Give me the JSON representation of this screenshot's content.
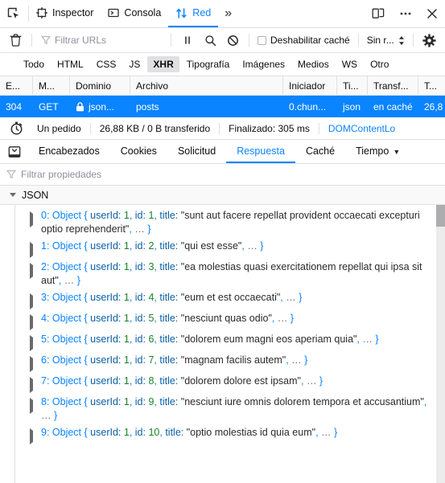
{
  "toolbox": {
    "picker_icon": "element-picker-icon",
    "tabs": [
      {
        "id": "inspector",
        "label": "Inspector",
        "icon": "inspector-icon",
        "selected": false
      },
      {
        "id": "console",
        "label": "Consola",
        "icon": "console-icon",
        "selected": false
      },
      {
        "id": "network",
        "label": "Red",
        "icon": "network-arrows-icon",
        "selected": true
      }
    ],
    "overflow_label": "»",
    "responsive_icon": "responsive-design-mode-icon",
    "meatball_label": "•••",
    "close_label": "✕"
  },
  "net_toolbar": {
    "clear_icon": "trash-icon",
    "filter_placeholder": "Filtrar URLs",
    "pause_icon": "pause-icon",
    "search_icon": "search-icon",
    "block_icon": "block-icon",
    "disable_cache_label": "Deshabilitar caché",
    "disable_cache_checked": false,
    "throttle_value": "Sin r...",
    "settings_icon": "gear-icon"
  },
  "type_filters": [
    {
      "label": "Todo",
      "active": false
    },
    {
      "label": "HTML",
      "active": false
    },
    {
      "label": "CSS",
      "active": false
    },
    {
      "label": "JS",
      "active": false
    },
    {
      "label": "XHR",
      "active": true
    },
    {
      "label": "Tipografía",
      "active": false
    },
    {
      "label": "Imágenes",
      "active": false
    },
    {
      "label": "Medios",
      "active": false
    },
    {
      "label": "WS",
      "active": false
    },
    {
      "label": "Otro",
      "active": false
    }
  ],
  "requests_table": {
    "columns": [
      {
        "key": "status",
        "label": "E..."
      },
      {
        "key": "method",
        "label": "M..."
      },
      {
        "key": "domain",
        "label": "Dominio"
      },
      {
        "key": "file",
        "label": "Archivo"
      },
      {
        "key": "initiator",
        "label": "Iniciador"
      },
      {
        "key": "type",
        "label": "Ti..."
      },
      {
        "key": "transferred",
        "label": "Transf..."
      },
      {
        "key": "size",
        "label": "T..."
      }
    ],
    "rows": [
      {
        "status": "304",
        "method": "GET",
        "lock_icon": "lock-icon",
        "domain": "json...",
        "file": "posts",
        "initiator": "0.chun...",
        "type": "json",
        "transferred": "en caché",
        "size": "26,8",
        "selected": true
      }
    ]
  },
  "summary": {
    "clock_icon": "stopwatch-icon",
    "requests": "Un pedido",
    "size": "26,88 KB / 0 B transferido",
    "finished": "Finalizado: 305 ms",
    "dom_content_loaded": "DOMContentLo"
  },
  "details": {
    "sidebar_toggle_icon": "panel-toggle-icon",
    "tabs": [
      {
        "label": "Encabezados",
        "selected": false
      },
      {
        "label": "Cookies",
        "selected": false
      },
      {
        "label": "Solicitud",
        "selected": false
      },
      {
        "label": "Respuesta",
        "selected": true
      },
      {
        "label": "Caché",
        "selected": false
      },
      {
        "label": "Tiempo",
        "selected": false
      }
    ],
    "overflow_caret": "▼",
    "props_filter_placeholder": "Filtrar propiedades",
    "json_section_label": "JSON"
  },
  "json_rows": [
    {
      "index": "0",
      "userId": "1",
      "id": "1",
      "title": "sunt aut facere repellat provident occaecati excepturi optio reprehenderit"
    },
    {
      "index": "1",
      "userId": "1",
      "id": "2",
      "title": "qui est esse"
    },
    {
      "index": "2",
      "userId": "1",
      "id": "3",
      "title": "ea molestias quasi exercitationem repellat qui ipsa sit aut"
    },
    {
      "index": "3",
      "userId": "1",
      "id": "4",
      "title": "eum et est occaecati"
    },
    {
      "index": "4",
      "userId": "1",
      "id": "5",
      "title": "nesciunt quas odio"
    },
    {
      "index": "5",
      "userId": "1",
      "id": "6",
      "title": "dolorem eum magni eos aperiam quia"
    },
    {
      "index": "6",
      "userId": "1",
      "id": "7",
      "title": "magnam facilis autem"
    },
    {
      "index": "7",
      "userId": "1",
      "id": "8",
      "title": "dolorem dolore est ipsam"
    },
    {
      "index": "8",
      "userId": "1",
      "id": "9",
      "title": "nesciunt iure omnis dolorem tempora et accusantium"
    },
    {
      "index": "9",
      "userId": "1",
      "id": "10",
      "title": "optio molestias id quia eum"
    }
  ],
  "json_tokens": {
    "object_label": "Object",
    "brace_open": "{",
    "brace_close": "}",
    "key_userid": "userId",
    "key_id": "id",
    "key_title": "title",
    "ellipsis": "…",
    "colon": ":",
    "comma": ","
  },
  "colors": {
    "accent": "#0a84ff",
    "selected_row_bg": "#0a84ff",
    "toolbar_bg": "#ffffff",
    "header_bg": "#f9f9fa",
    "border": "#e0e0e2",
    "text": "#0c0c0d",
    "muted": "#8f8f9d",
    "json_number_green": "#1a8229",
    "json_prop": "#0b5fa4",
    "scrollbar_thumb": "#adadb0"
  }
}
